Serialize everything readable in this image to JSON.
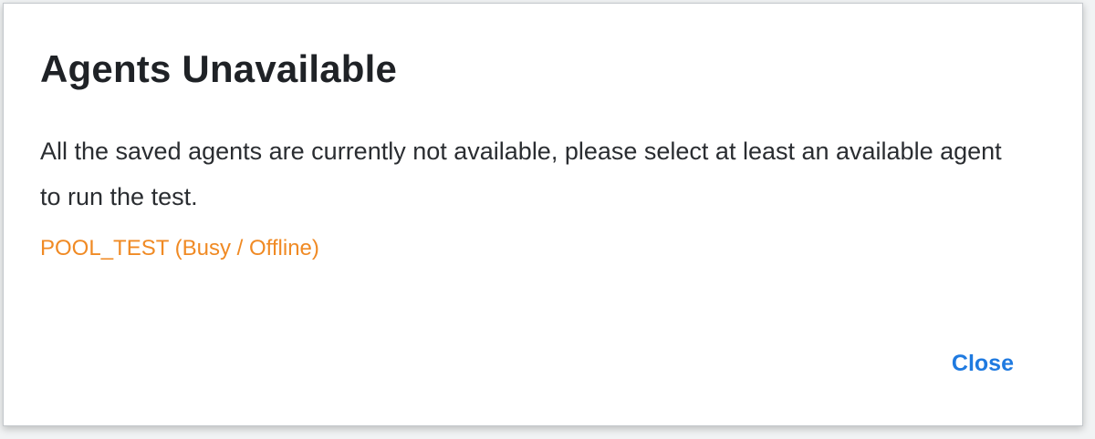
{
  "dialog": {
    "title": "Agents Unavailable",
    "message": "All the saved agents are currently not available, please select at least an available agent to run the test.",
    "agent_status": "POOL_TEST (Busy / Offline)",
    "close_label": "Close"
  },
  "colors": {
    "title": "#1f2226",
    "body_text": "#2a2d31",
    "warning": "#f08a24",
    "link": "#1f7ae0"
  }
}
